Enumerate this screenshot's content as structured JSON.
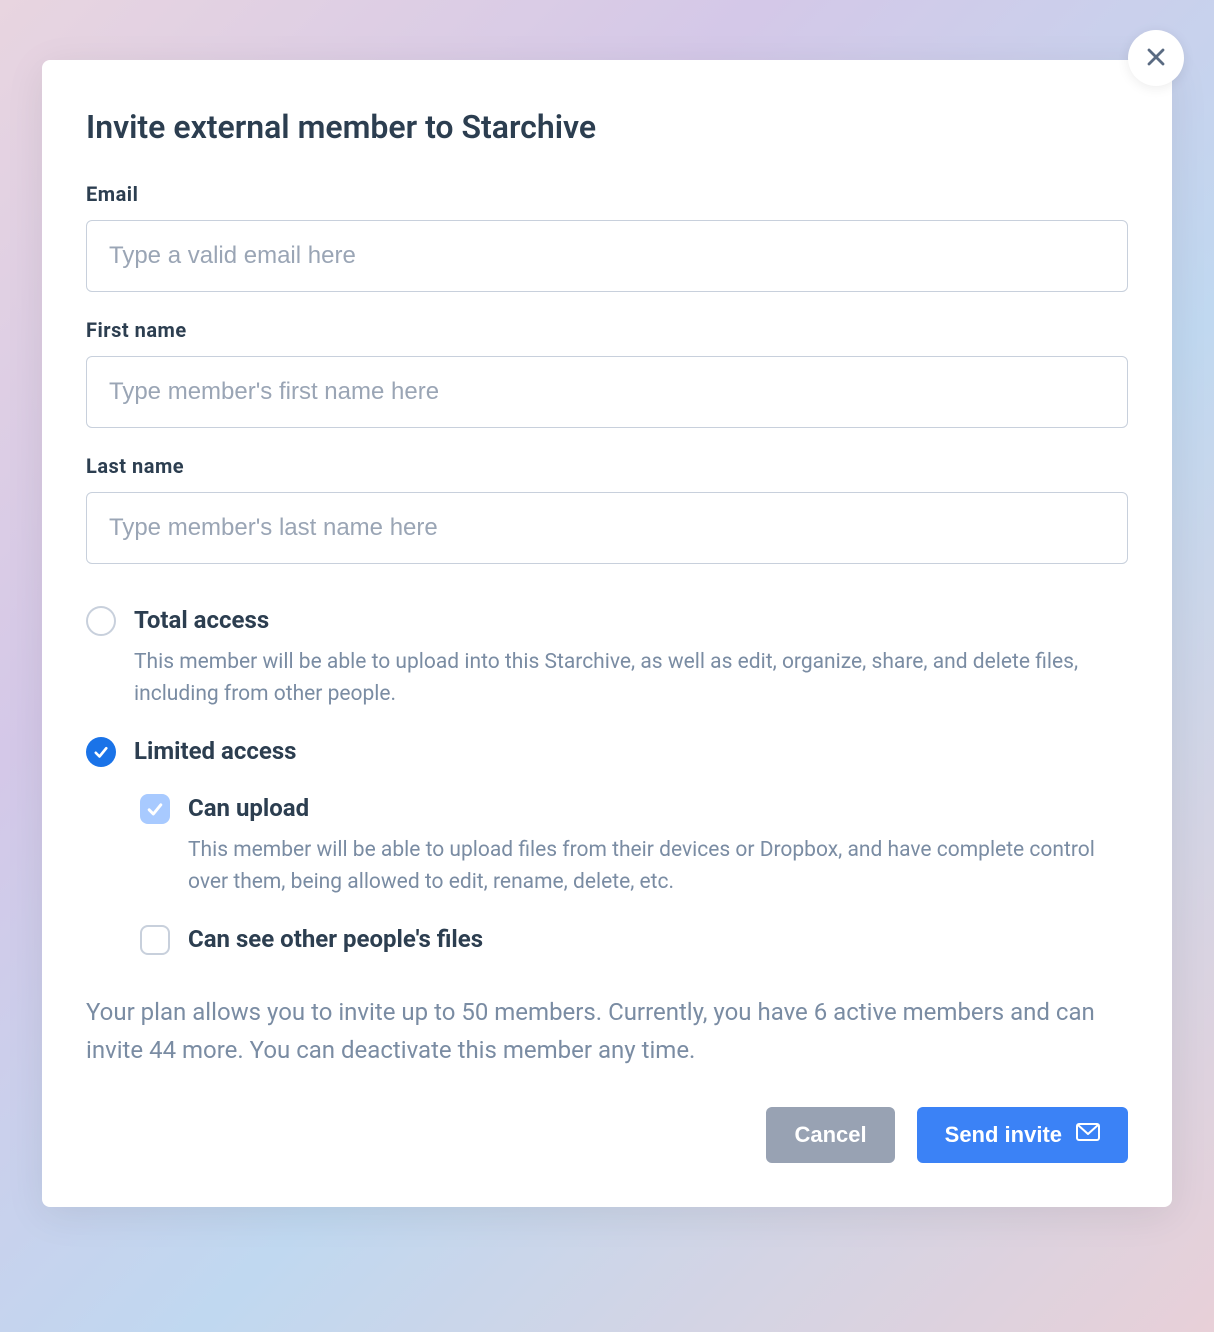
{
  "modal": {
    "title": "Invite external member to Starchive",
    "fields": {
      "email": {
        "label": "Email",
        "placeholder": "Type a valid email here",
        "value": ""
      },
      "first_name": {
        "label": "First name",
        "placeholder": "Type member's first name here",
        "value": ""
      },
      "last_name": {
        "label": "Last name",
        "placeholder": "Type member's last name here",
        "value": ""
      }
    },
    "access": {
      "total": {
        "title": "Total access",
        "desc": "This member will be able to upload into this Starchive, as well as edit, organize, share, and delete files, including from other people.",
        "selected": false
      },
      "limited": {
        "title": "Limited access",
        "selected": true,
        "sub": {
          "can_upload": {
            "title": "Can upload",
            "desc": "This member will be able to upload files from their devices or Dropbox, and have complete control over them, being allowed to edit, rename, delete, etc.",
            "checked": true
          },
          "can_see_others": {
            "title": "Can see other people's files",
            "checked": false
          }
        }
      }
    },
    "plan_info": "Your plan allows you to invite up to 50 members. Currently, you have 6 active members and can invite 44 more. You can deactivate this member any time.",
    "buttons": {
      "cancel": "Cancel",
      "send": "Send invite"
    }
  }
}
